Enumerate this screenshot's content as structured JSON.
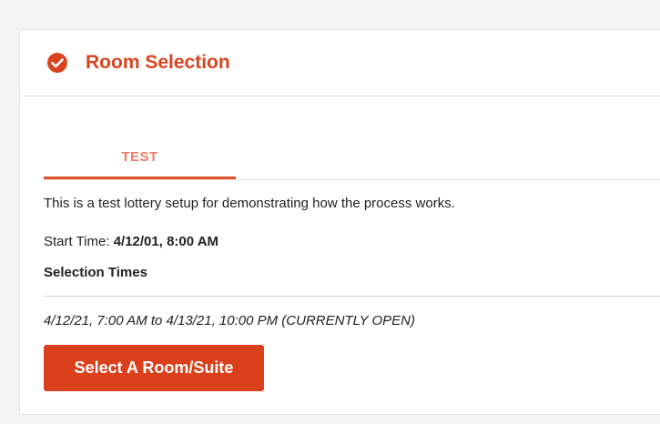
{
  "header": {
    "title": "Room Selection",
    "icon": "check-circle-icon",
    "accent_color": "#d9441f"
  },
  "tabs": [
    {
      "label": "TEST",
      "active": true
    }
  ],
  "lottery": {
    "description": "This is a test lottery setup for demonstrating how the process works.",
    "start_time_label": "Start Time: ",
    "start_time_value": "4/12/01, 8:00 AM",
    "selection_times_heading": "Selection Times",
    "selection_range": "4/12/21, 7:00 AM to 4/13/21, 10:00 PM (CURRENTLY OPEN)"
  },
  "actions": {
    "select_button_label": "Select A Room/Suite",
    "button_color": "#d9401b"
  }
}
